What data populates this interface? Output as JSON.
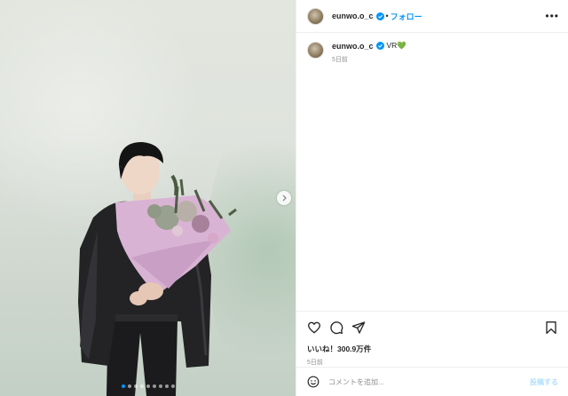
{
  "post": {
    "username": "eunwo.o_c",
    "follow_label": "フォロー",
    "separator": "•",
    "more_label": "•••",
    "caption_text": "VR💚",
    "caption_age": "5日前",
    "likes_text": "いいね！300.9万件",
    "post_date": "5日前",
    "carousel": {
      "slide_count": 9,
      "active_index": 0
    }
  },
  "comment": {
    "placeholder": "コメントを追加...",
    "post_label": "投稿する"
  },
  "icons": {
    "verified": "verified-badge-icon",
    "like": "heart-icon",
    "comment": "comment-icon",
    "share": "paper-plane-icon",
    "save": "bookmark-icon",
    "emoji": "emoji-smiley-icon",
    "next": "chevron-right-icon"
  },
  "colors": {
    "accent": "#0095f6",
    "text": "#262626",
    "muted": "#8e8e8e",
    "post_disabled": "#b2dffc"
  }
}
